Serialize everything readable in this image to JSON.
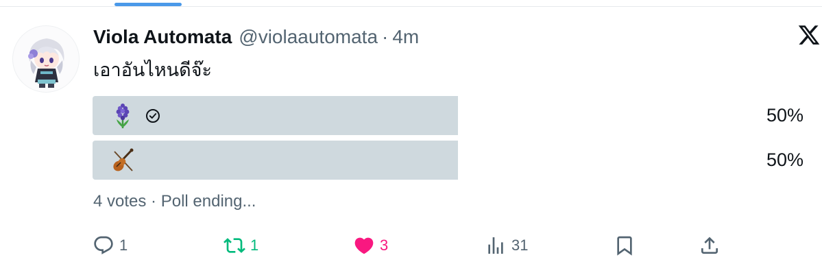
{
  "tweet": {
    "author_name": "Viola Automata",
    "author_handle": "@violaautomata",
    "separator": "·",
    "timestamp": "4m",
    "text": "เอาอันไหนดีจ๊ะ"
  },
  "poll": {
    "options": [
      {
        "icon": "hyacinth-emoji",
        "voted": true,
        "percent_label": "50%",
        "fraction": 0.5
      },
      {
        "icon": "violin-emoji",
        "voted": false,
        "percent_label": "50%",
        "fraction": 0.5
      }
    ],
    "meta": "4 votes · Poll ending..."
  },
  "actions": {
    "reply_count": "1",
    "retweet_count": "1",
    "like_count": "3",
    "views_count": "31"
  },
  "colors": {
    "poll_bar": "#cfd9de",
    "retweet_active": "#00ba7c",
    "like_active": "#f91880",
    "muted": "#536471",
    "tab_indicator": "#4a99e9"
  }
}
